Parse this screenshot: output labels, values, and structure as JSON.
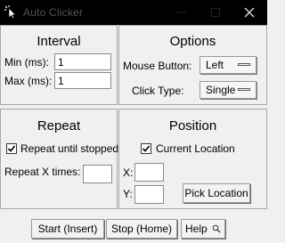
{
  "window": {
    "title": "Auto Clicker",
    "icon": "cursor-click-icon"
  },
  "interval": {
    "title": "Interval",
    "min_label": "Min (ms):",
    "min_value": "1",
    "max_label": "Max (ms):",
    "max_value": "1"
  },
  "options": {
    "title": "Options",
    "mouse_button_label": "Mouse Button:",
    "mouse_button_value": "Left",
    "click_type_label": "Click Type:",
    "click_type_value": "Single"
  },
  "repeat": {
    "title": "Repeat",
    "until_stopped_label": "Repeat until stopped",
    "until_stopped_checked": true,
    "times_label": "Repeat X times:",
    "times_value": ""
  },
  "position": {
    "title": "Position",
    "current_label": "Current Location",
    "current_checked": true,
    "x_label": "X:",
    "x_value": "",
    "y_label": "Y:",
    "y_value": "",
    "pick_label": "Pick Location"
  },
  "buttons": {
    "start_label": "Start (Insert)",
    "stop_label": "Stop (Home)",
    "help_label": "Help",
    "help_icon": "magnifier-icon"
  }
}
